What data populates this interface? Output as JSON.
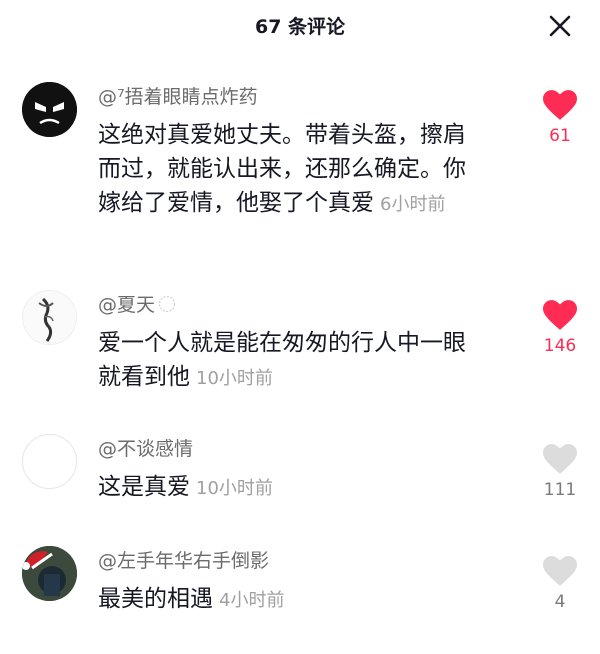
{
  "header": {
    "title": "67 条评论"
  },
  "colors": {
    "liked": "#fe2c55",
    "unliked": "#dcdcdc"
  },
  "comments": [
    {
      "user": "@⁷捂着眼睛点炸药",
      "text": "这绝对真爱她丈夫。带着头盔，擦肩而过，就能认出来，还那么确定。你嫁给了爱情，他娶了个真爱",
      "time": "6小时前",
      "likes": "61",
      "liked": true
    },
    {
      "user": "@夏天",
      "text": "爱一个人就是能在匆匆的行人中一眼就看到他",
      "time": "10小时前",
      "likes": "146",
      "liked": true
    },
    {
      "user": "@不谈感情",
      "text": "这是真爱",
      "time": "10小时前",
      "likes": "111",
      "liked": false
    },
    {
      "user": "@左手年华右手倒影",
      "text": "最美的相遇",
      "time": "4小时前",
      "likes": "4",
      "liked": false
    }
  ]
}
